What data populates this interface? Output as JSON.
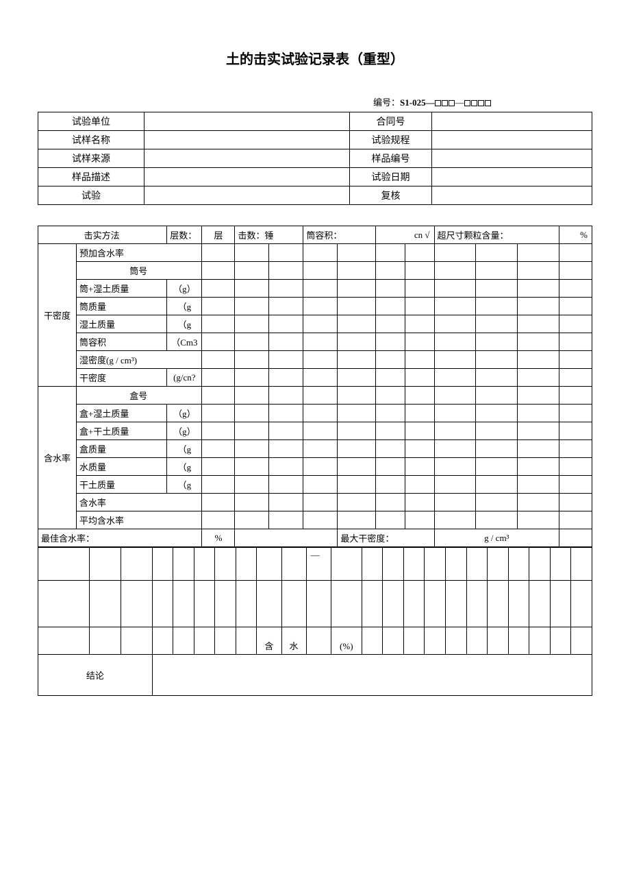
{
  "title": "土的击实试验记录表（重型）",
  "serial": {
    "label": "编号：",
    "code": "S1-025—"
  },
  "header": {
    "rows": [
      {
        "left": "试验单位",
        "right": "合同号"
      },
      {
        "left": "试样名称",
        "right": "试验规程"
      },
      {
        "left": "试样来源",
        "right": "样品编号"
      },
      {
        "left": "样品描述",
        "right": "试验日期"
      },
      {
        "left": "试验",
        "right": "复核"
      }
    ]
  },
  "main": {
    "row1": {
      "c1": "击实方法",
      "c2a": "层数：",
      "c2b": "层",
      "c3": "击数：锤",
      "c4a": "筒容积：",
      "c4b": "cn √",
      "c5a": "超尺寸颗粒含量：",
      "c5b": "%"
    },
    "density_group": "干密度",
    "density_rows": [
      {
        "label": "预加含水率",
        "unit": ""
      },
      {
        "label": "筒号",
        "unit": ""
      },
      {
        "label": "筒+湿土质量",
        "unit": "（g）"
      },
      {
        "label": "筒质量",
        "unit": "（g"
      },
      {
        "label": "湿土质量",
        "unit": "（g"
      },
      {
        "label": "筒容积",
        "unit": "（Cm3"
      },
      {
        "label": "湿密度(g / cm³)",
        "unit": ""
      },
      {
        "label": "干密度",
        "unit": "(g/cn?"
      }
    ],
    "water_group": "含水率",
    "water_rows": [
      {
        "label": "盒号",
        "unit": ""
      },
      {
        "label": "盒+湿土质量",
        "unit": "（g）"
      },
      {
        "label": "盒+干土质量",
        "unit": "（g）"
      },
      {
        "label": "盒质量",
        "unit": "（g"
      },
      {
        "label": "水质量",
        "unit": "（g"
      },
      {
        "label": "干土质量",
        "unit": "（g"
      },
      {
        "label": "含水率",
        "unit": ""
      },
      {
        "label": "平均含水率",
        "unit": ""
      }
    ],
    "result_row": {
      "left_label": "最佳含水率：",
      "left_unit": "%",
      "right_label": "最大干密度：",
      "right_unit": "g / cm³"
    },
    "grid": {
      "dash": "—",
      "han": "含",
      "shui": "水",
      "pct": "(%)"
    },
    "conclusion": "结论"
  }
}
